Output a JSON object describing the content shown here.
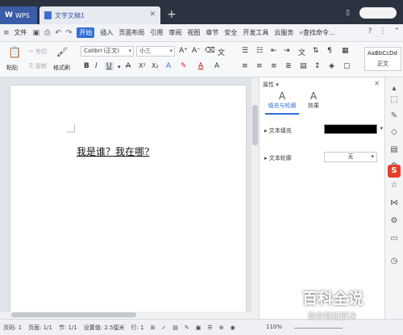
{
  "titlebar": {
    "app_tab": "WPS",
    "doc_tab": "文字文稿1",
    "add_tab": "+"
  },
  "menu": {
    "file": "文件",
    "items": [
      "开始",
      "插入",
      "页面布局",
      "引用",
      "审阅",
      "视图",
      "章节",
      "安全",
      "开发工具",
      "云服务"
    ],
    "search": "查找命令..."
  },
  "ribbon": {
    "paste": "粘贴",
    "cut": "剪切",
    "copy": "复制",
    "format_painter": "格式刷",
    "font_name": "Calibri (正文)",
    "font_size": "小三",
    "style_sample": "AaBbCcDd",
    "style_name": "正文"
  },
  "document": {
    "text": "我是谁？我在哪?"
  },
  "panel": {
    "title": "属性",
    "tab_fill": "填充与轮廓",
    "tab_effect": "效果",
    "fill_label": "文本填充",
    "outline_label": "文本轮廓",
    "outline_value": "无"
  },
  "status": {
    "words": "页码: 1",
    "page": "页面: 1/1",
    "section": "节: 1/1",
    "setting": "设置值: 2.5厘米",
    "row": "行: 1",
    "zoom": "110%"
  },
  "watermark": {
    "title": "百科全说",
    "subtitle": "助你轻松解决"
  },
  "colors": {
    "accent": "#2f6fd6",
    "titlebar": "#2b3340",
    "fill_swatch": "#000000"
  }
}
